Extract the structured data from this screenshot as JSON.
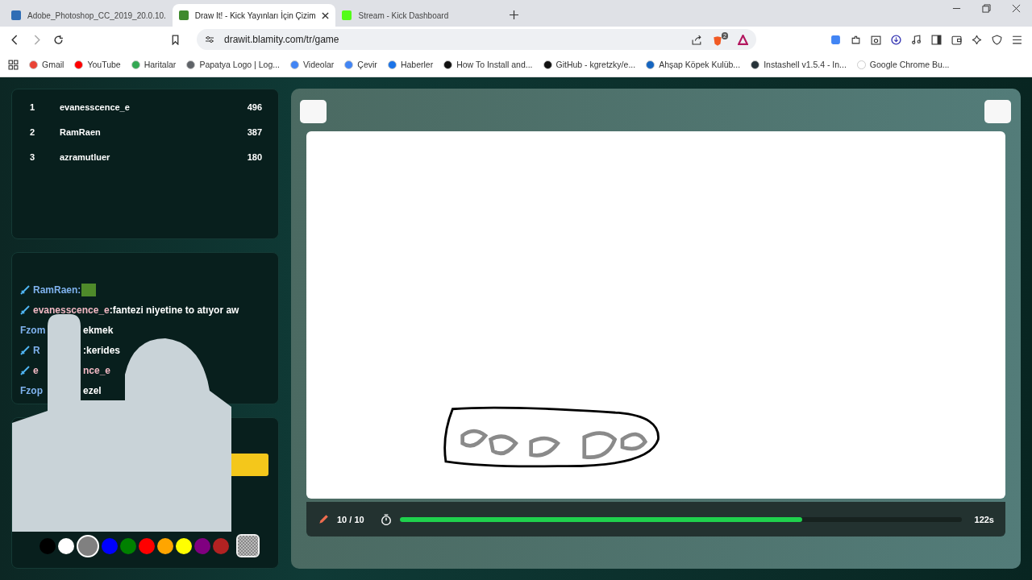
{
  "browser": {
    "tabs": [
      {
        "title": "Adobe_Photoshop_CC_2019_20.0.10.",
        "selected": false,
        "color": "#2f6db5"
      },
      {
        "title": "Draw It! - Kick Yayınları İçin Çizim",
        "selected": true,
        "color": "#3f8a2e"
      },
      {
        "title": "Stream - Kick Dashboard",
        "selected": false,
        "color": "#53fc18"
      }
    ],
    "url": "drawit.blamity.com/tr/game",
    "extension_badge": "2",
    "bookmarks": [
      {
        "label": "Gmail",
        "color": "#ea4335"
      },
      {
        "label": "YouTube",
        "color": "#ff0000"
      },
      {
        "label": "Haritalar",
        "color": "#34a853"
      },
      {
        "label": "Papatya Logo | Log...",
        "color": "#5f6368"
      },
      {
        "label": "Videolar",
        "color": "#4285f4"
      },
      {
        "label": "Çevir",
        "color": "#4285f4"
      },
      {
        "label": "Haberler",
        "color": "#1a73e8"
      },
      {
        "label": "How To Install and...",
        "color": "#111111"
      },
      {
        "label": "GitHub - kgretzky/e...",
        "color": "#111111"
      },
      {
        "label": "Ahşap Köpek Kulüb...",
        "color": "#1565c0"
      },
      {
        "label": "Instashell v1.5.4 - In...",
        "color": "#263238"
      },
      {
        "label": "Google Chrome Bu...",
        "color": "#ffffff"
      }
    ]
  },
  "leaderboard": [
    {
      "rank": "1",
      "name": "evanesscence_e",
      "score": "496"
    },
    {
      "rank": "2",
      "name": "RamRaen",
      "score": "387"
    },
    {
      "rank": "3",
      "name": "azramutluer",
      "score": "180"
    }
  ],
  "chat": [
    {
      "badge": true,
      "emote": true,
      "pieces": [
        {
          "text": "RamRaen:",
          "color": "#7fb2ee"
        }
      ]
    },
    {
      "badge": true,
      "pieces": [
        {
          "text": "evanesscence_e",
          "color": "#f2b9c4"
        },
        {
          "text": ":fantezi niyetine to atıyor aw",
          "color": "#ffffff"
        }
      ]
    },
    {
      "pieces": [
        {
          "text": "Fzom",
          "color": "#7fb2ee"
        },
        {
          "text": "ekmek",
          "color": "#ffffff",
          "gap": true
        }
      ]
    },
    {
      "badge": true,
      "pieces": [
        {
          "text": "R",
          "color": "#7fb2ee"
        },
        {
          "text": ":kerides",
          "color": "#ffffff",
          "gap": true
        }
      ]
    },
    {
      "badge": true,
      "pieces": [
        {
          "text": "e",
          "color": "#f2b9c4"
        },
        {
          "text": "nce_e",
          "color": "#f2b9c4",
          "gap": true
        }
      ]
    },
    {
      "pieces": [
        {
          "text": "Fzop",
          "color": "#7fb2ee"
        },
        {
          "text": "ezel",
          "color": "#ffffff",
          "gap": true
        }
      ]
    }
  ],
  "palette": [
    {
      "kind": "solid",
      "color": "#000000",
      "selected": false
    },
    {
      "kind": "solid",
      "color": "#ffffff",
      "selected": false
    },
    {
      "kind": "solid",
      "color": "#808080",
      "selected": true
    },
    {
      "kind": "solid",
      "color": "#0000ff",
      "selected": false
    },
    {
      "kind": "solid",
      "color": "#008000",
      "selected": false
    },
    {
      "kind": "solid",
      "color": "#ff0000",
      "selected": false
    },
    {
      "kind": "solid",
      "color": "#ffa500",
      "selected": false
    },
    {
      "kind": "solid",
      "color": "#ffff00",
      "selected": false
    },
    {
      "kind": "solid",
      "color": "#800080",
      "selected": false
    },
    {
      "kind": "solid",
      "color": "#b22222",
      "selected": false
    },
    {
      "kind": "pattern",
      "selected": false
    }
  ],
  "round": "10 / 10",
  "timer": {
    "level": 0.717,
    "reading": "122s"
  }
}
